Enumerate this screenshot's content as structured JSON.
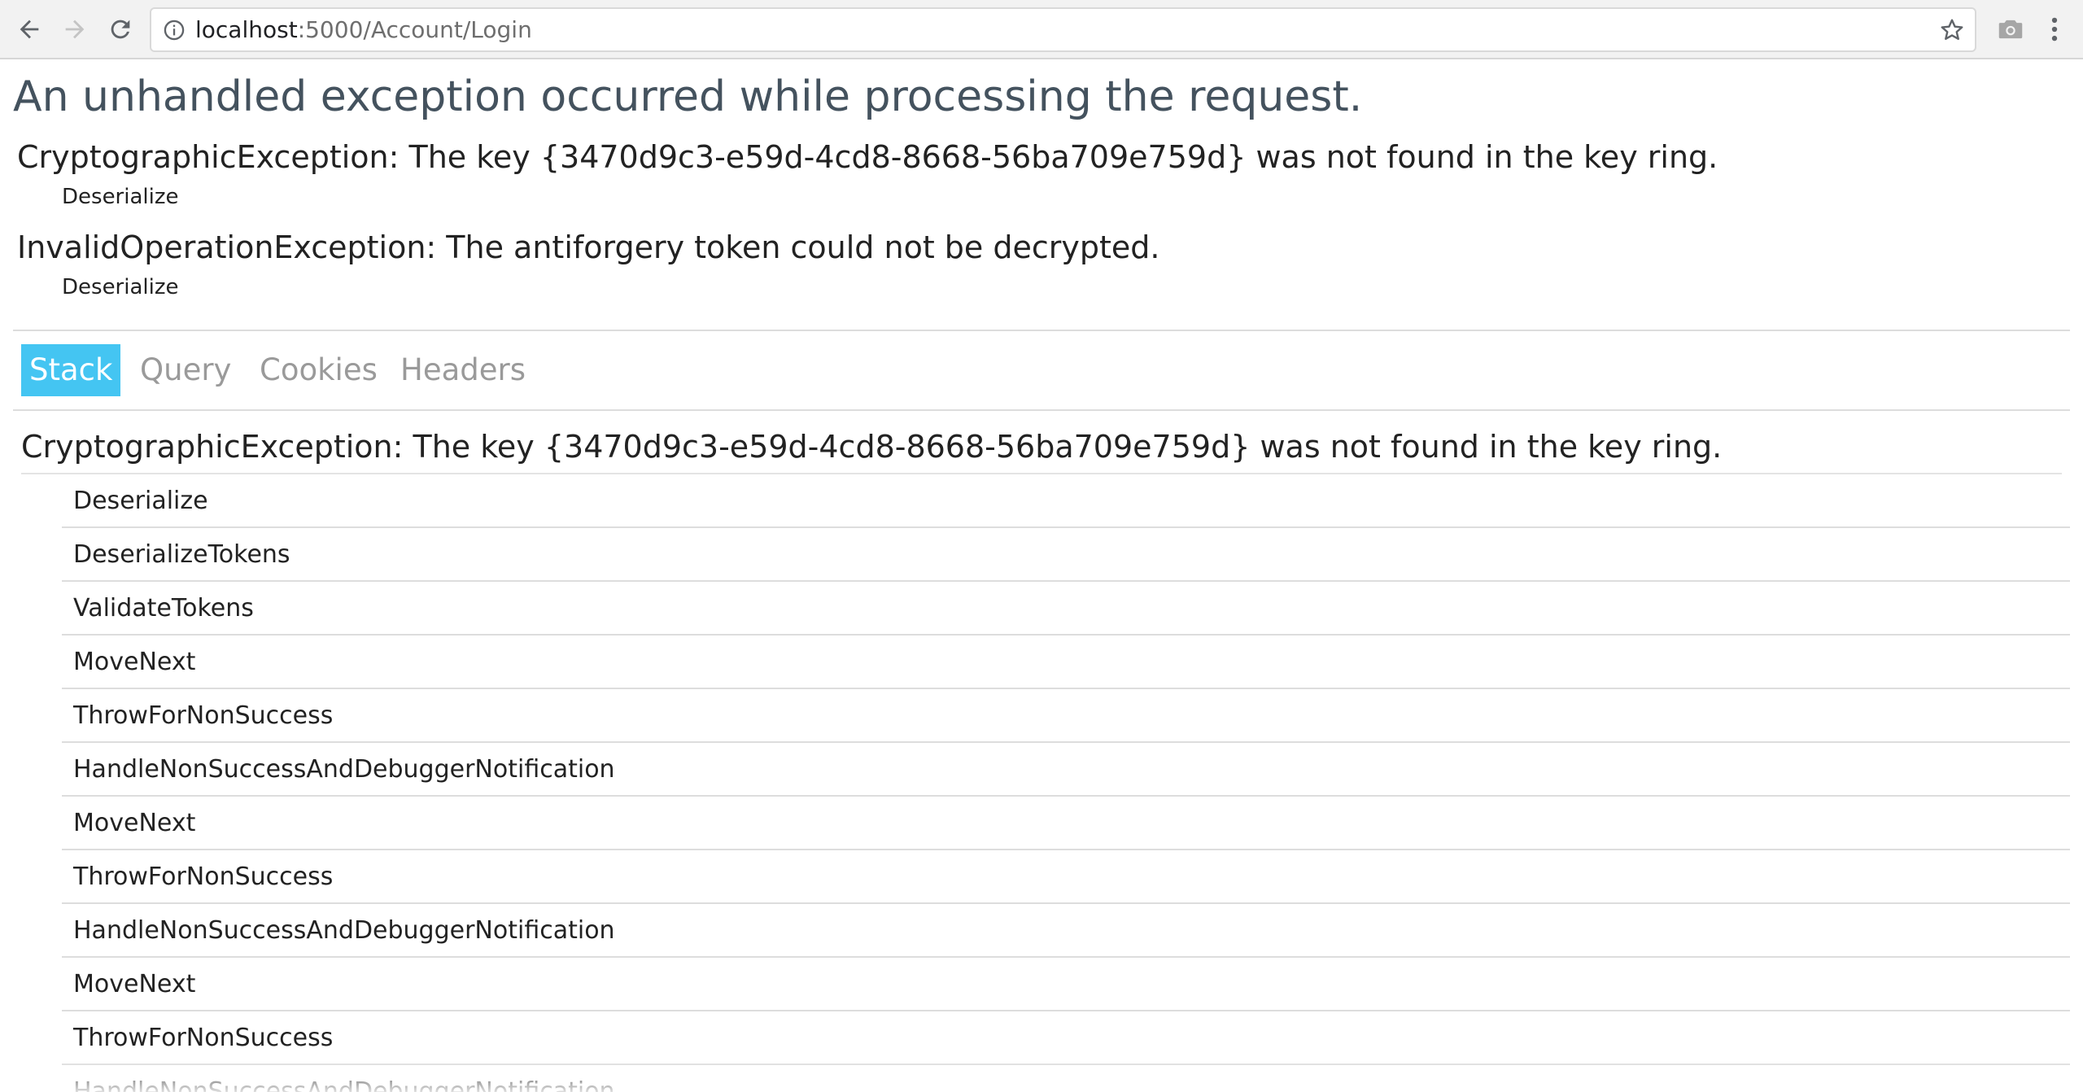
{
  "browser": {
    "url_host": "localhost",
    "url_path": ":5000/Account/Login",
    "icons": {
      "back": "back-arrow-icon",
      "forward": "forward-arrow-icon",
      "reload": "reload-icon",
      "info": "info-icon",
      "bookmark": "star-icon",
      "screenshot": "camera-icon",
      "menu": "kebab-menu-icon"
    }
  },
  "page": {
    "title": "An unhandled exception occurred while processing the request.",
    "exceptions": [
      {
        "title": "CryptographicException: The key {3470d9c3-e59d-4cd8-8668-56ba709e759d} was not found in the key ring.",
        "method": "Deserialize"
      },
      {
        "title": "InvalidOperationException: The antiforgery token could not be decrypted.",
        "method": "Deserialize"
      }
    ],
    "tabs": [
      {
        "label": "Stack",
        "selected": true
      },
      {
        "label": "Query",
        "selected": false
      },
      {
        "label": "Cookies",
        "selected": false
      },
      {
        "label": "Headers",
        "selected": false
      }
    ],
    "stack": {
      "title": "CryptographicException: The key {3470d9c3-e59d-4cd8-8668-56ba709e759d} was not found in the key ring.",
      "frames": [
        "Deserialize",
        "DeserializeTokens",
        "ValidateTokens",
        "MoveNext",
        "ThrowForNonSuccess",
        "HandleNonSuccessAndDebuggerNotification",
        "MoveNext",
        "ThrowForNonSuccess",
        "HandleNonSuccessAndDebuggerNotification",
        "MoveNext",
        "ThrowForNonSuccess",
        "HandleNonSuccessAndDebuggerNotification"
      ]
    }
  },
  "colors": {
    "accent": "#44c5f2",
    "title": "#44525e",
    "text": "#222222",
    "muted": "#9a9a9a"
  }
}
